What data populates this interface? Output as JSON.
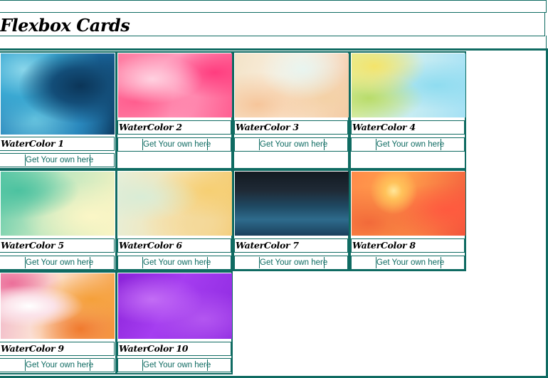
{
  "header": {
    "title": "Flexbox Cards"
  },
  "cards": [
    {
      "name": "WaterColor 1",
      "link": "Get Your own here",
      "image": "watercolor-blue"
    },
    {
      "name": "WaterColor 2",
      "link": "Get Your own here",
      "image": "watercolor-pink"
    },
    {
      "name": "WaterColor 3",
      "link": "Get Your own here",
      "image": "watercolor-peach"
    },
    {
      "name": "WaterColor 4",
      "link": "Get Your own here",
      "image": "watercolor-yellow-cyan"
    },
    {
      "name": "WaterColor 5",
      "link": "Get Your own here",
      "image": "watercolor-teal-cream"
    },
    {
      "name": "WaterColor 6",
      "link": "Get Your own here",
      "image": "watercolor-mint-gold"
    },
    {
      "name": "WaterColor 7",
      "link": "Get Your own here",
      "image": "watercolor-dark-navy"
    },
    {
      "name": "WaterColor 8",
      "link": "Get Your own here",
      "image": "watercolor-orange"
    },
    {
      "name": "WaterColor 9",
      "link": "Get Your own here",
      "image": "watercolor-pink-orange"
    },
    {
      "name": "WaterColor 10",
      "link": "Get Your own here",
      "image": "watercolor-purple"
    }
  ],
  "colors": {
    "accent": "#0f6b62",
    "background": "#ffffff"
  }
}
